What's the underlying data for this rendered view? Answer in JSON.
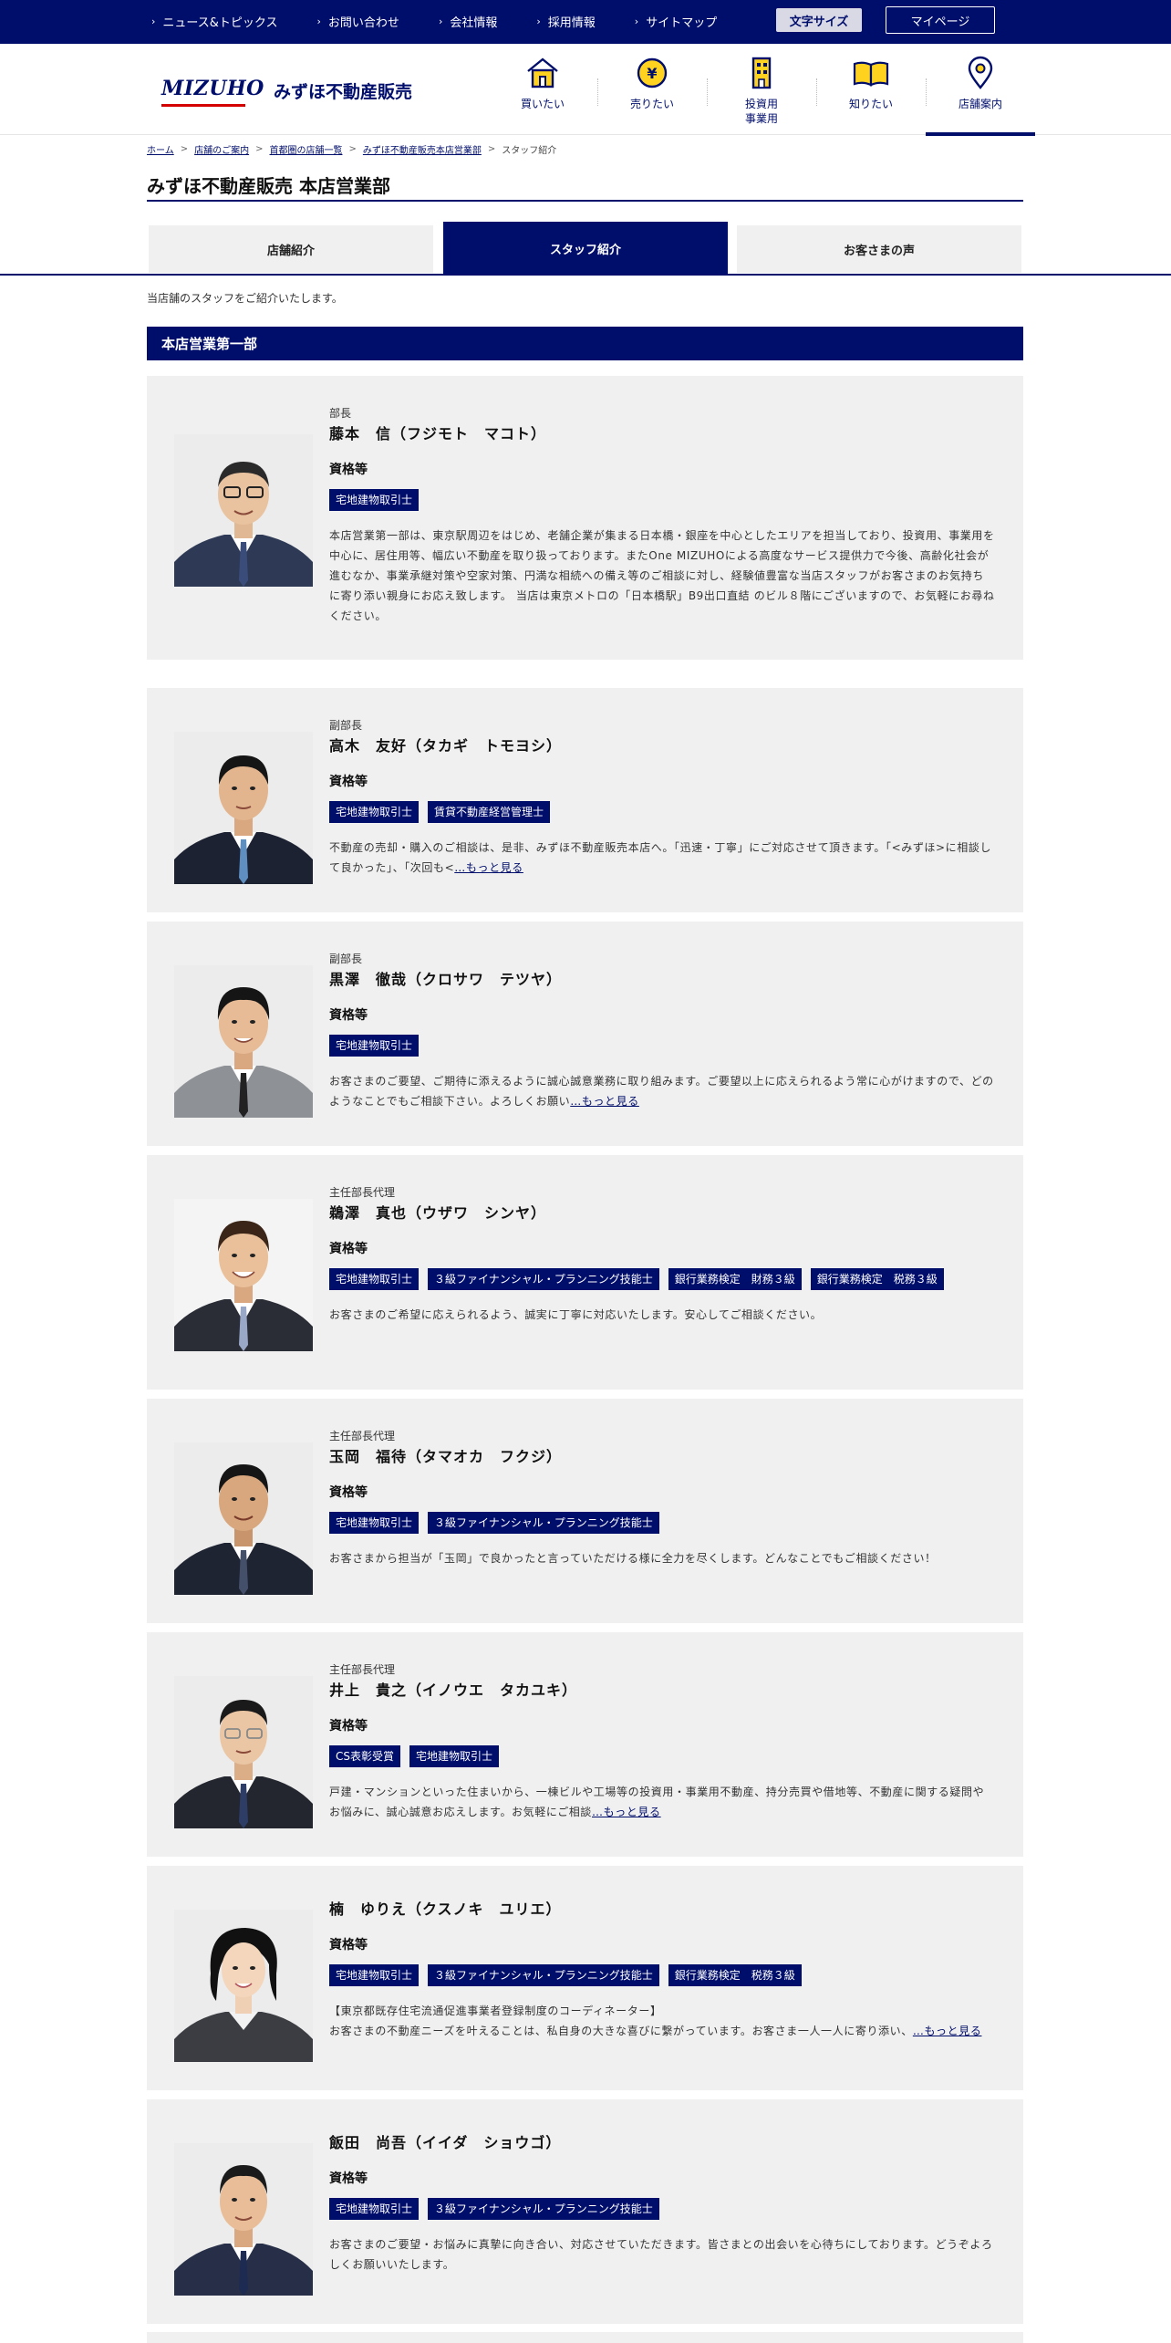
{
  "topnav": {
    "items": [
      {
        "label": "ニュース&トピックス"
      },
      {
        "label": "お問い合わせ"
      },
      {
        "label": "会社情報"
      },
      {
        "label": "採用情報"
      },
      {
        "label": "サイトマップ"
      }
    ],
    "fontsize_label": "文字サイズ",
    "mypage_label": "マイページ"
  },
  "header": {
    "logo_en": "MIZUHO",
    "logo_ja": "みずほ不動産販売",
    "nav": [
      {
        "label": "買いたい",
        "icon": "house-icon"
      },
      {
        "label": "売りたい",
        "icon": "yen-icon"
      },
      {
        "label": "投資用\n事業用",
        "icon": "building-icon"
      },
      {
        "label": "知りたい",
        "icon": "book-icon"
      },
      {
        "label": "店舗案内",
        "icon": "map-pin-icon",
        "active": true
      }
    ]
  },
  "breadcrumb": {
    "items": [
      "ホーム",
      "店舗のご案内",
      "首都圏の店舗一覧",
      "みずほ不動産販売本店営業部",
      "スタッフ紹介"
    ]
  },
  "page_title": "みずほ不動産販売 本店営業部",
  "tabs": [
    {
      "label": "店舗紹介"
    },
    {
      "label": "スタッフ紹介",
      "active": true
    },
    {
      "label": "お客さまの声"
    }
  ],
  "intro": "当店舗のスタッフをご紹介いたします。",
  "section_title": "本店営業第一部",
  "qual_heading": "資格等",
  "more_label": "…もっと見る",
  "staff": [
    {
      "role": "部長",
      "name": "藤本　信（フジモト　マコト）",
      "quals": [
        "宅地建物取引士"
      ],
      "desc": "本店営業第一部は、東京駅周辺をはじめ、老舗企業が集まる日本橋・銀座を中心としたエリアを担当しており、投資用、事業用を中心に、居住用等、幅広い不動産を取り扱っております。またOne MIZUHOによる高度なサービス提供力で今後、高齢化社会が進むなか、事業承継対策や空家対策、円満な相続への備え等のご相談に対し、経験値豊富な当店スタッフがお客さまのお気持ちに寄り添い親身にお応え致します。 当店は東京メトロの「日本橋駅」B9出口直結 のビル８階にございますので、お気軽にお尋ねください。",
      "more": false
    },
    {
      "role": "副部長",
      "name": "高木　友好（タカギ　トモヨシ）",
      "quals": [
        "宅地建物取引士",
        "賃貸不動産経営管理士"
      ],
      "desc": "不動産の売却・購入のご相談は、是非、みずほ不動産販売本店へ。「迅速・丁寧」にご対応させて頂きます。「<みずほ>に相談して良かった」、「次回も<",
      "more": true
    },
    {
      "role": "副部長",
      "name": "黒澤　徹哉（クロサワ　テツヤ）",
      "quals": [
        "宅地建物取引士"
      ],
      "desc": "お客さまのご要望、ご期待に添えるように誠心誠意業務に取り組みます。ご要望以上に応えられるよう常に心がけますので、どのようなことでもご相談下さい。よろしくお願い",
      "more": true
    },
    {
      "role": "主任部長代理",
      "name": "鵜澤　真也（ウザワ　シンヤ）",
      "quals": [
        "宅地建物取引士",
        "３級ファイナンシャル・プランニング技能士",
        "銀行業務検定　財務３級",
        "銀行業務検定　税務３級"
      ],
      "desc": "お客さまのご希望に応えられるよう、誠実に丁寧に対応いたします。安心してご相談ください。",
      "more": false
    },
    {
      "role": "主任部長代理",
      "name": "玉岡　福待（タマオカ　フクジ）",
      "quals": [
        "宅地建物取引士",
        "３級ファイナンシャル・プランニング技能士"
      ],
      "desc": "お客さまから担当が「玉岡」で良かったと言っていただける様に全力を尽くします。どんなことでもご相談ください！",
      "more": false
    },
    {
      "role": "主任部長代理",
      "name": "井上　貴之（イノウエ　タカユキ）",
      "quals": [
        "CS表彰受賞",
        "宅地建物取引士"
      ],
      "desc": "戸建・マンションといった住まいから、一棟ビルや工場等の投資用・事業用不動産、持分売買や借地等、不動産に関する疑問やお悩みに、誠心誠意お応えします。お気軽にご相談",
      "more": true
    },
    {
      "role": "",
      "name": "楠　ゆりえ（クスノキ　ユリエ）",
      "quals": [
        "宅地建物取引士",
        "３級ファイナンシャル・プランニング技能士",
        "銀行業務検定　税務３級"
      ],
      "desc": "【東京都既存住宅流通促進事業者登録制度のコーディネーター】\nお客さまの不動産ニーズを叶えることは、私自身の大きな喜びに繋がっています。お客さま一人一人に寄り添い、",
      "more": true
    },
    {
      "role": "",
      "name": "飯田　尚吾（イイダ　ショウゴ）",
      "quals": [
        "宅地建物取引士",
        "３級ファイナンシャル・プランニング技能士"
      ],
      "desc": "お客さまのご要望・お悩みに真摯に向き合い、対応させていただきます。皆さまとの出会いを心待ちにしております。どうぞよろしくお願いいたします。",
      "more": false
    }
  ]
}
